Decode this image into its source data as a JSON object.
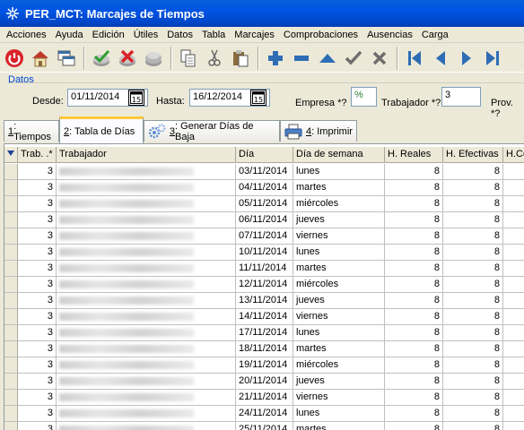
{
  "window": {
    "title": "PER_MCT: Marcajes de Tiempos"
  },
  "menu": [
    "Acciones",
    "Ayuda",
    "Edición",
    "Útiles",
    "Datos",
    "Tabla",
    "Marcajes",
    "Comprobaciones",
    "Ausencias",
    "Carga"
  ],
  "toolbar": {
    "buttons": [
      "power-icon",
      "home-icon",
      "windows-icon",
      "check-all-icon",
      "cancel-all-icon",
      "refresh-icon",
      "copy-icon",
      "cut-icon",
      "paste-icon",
      "add-icon",
      "remove-icon",
      "up-icon",
      "accept-icon",
      "cancel-icon",
      "first-icon",
      "previous-icon",
      "next-icon",
      "last-icon"
    ]
  },
  "filters": {
    "legend": "Datos",
    "desde_label": "Desde:",
    "desde_value": "01/11/2014",
    "hasta_label": "Hasta:",
    "hasta_value": "16/12/2014",
    "calendar_glyph": "15",
    "empresa_label": "Empresa *?",
    "empresa_value": "%",
    "trabajador_label": "Trabajador *?",
    "trabajador_value": "3",
    "prov_label": "Prov. *?"
  },
  "tabs": [
    {
      "key": "1",
      "label": ": Tiempos"
    },
    {
      "key": "2",
      "label": ": Tabla de Días"
    },
    {
      "key": "3",
      "label": ": Generar Días de Baja"
    },
    {
      "key": "4",
      "label": ": Imprimir"
    }
  ],
  "grid": {
    "columns": [
      "",
      "Trab. .*",
      "Trabajador",
      "Día",
      "Día de semana",
      "H. Reales",
      "H. Efectivas",
      "H.Co"
    ],
    "rows": [
      {
        "trab": "3",
        "dia": "03/11/2014",
        "semana": "lunes",
        "reales": "8",
        "efectivas": "8"
      },
      {
        "trab": "3",
        "dia": "04/11/2014",
        "semana": "martes",
        "reales": "8",
        "efectivas": "8"
      },
      {
        "trab": "3",
        "dia": "05/11/2014",
        "semana": "miércoles",
        "reales": "8",
        "efectivas": "8"
      },
      {
        "trab": "3",
        "dia": "06/11/2014",
        "semana": "jueves",
        "reales": "8",
        "efectivas": "8"
      },
      {
        "trab": "3",
        "dia": "07/11/2014",
        "semana": "viernes",
        "reales": "8",
        "efectivas": "8"
      },
      {
        "trab": "3",
        "dia": "10/11/2014",
        "semana": "lunes",
        "reales": "8",
        "efectivas": "8"
      },
      {
        "trab": "3",
        "dia": "11/11/2014",
        "semana": "martes",
        "reales": "8",
        "efectivas": "8"
      },
      {
        "trab": "3",
        "dia": "12/11/2014",
        "semana": "miércoles",
        "reales": "8",
        "efectivas": "8"
      },
      {
        "trab": "3",
        "dia": "13/11/2014",
        "semana": "jueves",
        "reales": "8",
        "efectivas": "8"
      },
      {
        "trab": "3",
        "dia": "14/11/2014",
        "semana": "viernes",
        "reales": "8",
        "efectivas": "8"
      },
      {
        "trab": "3",
        "dia": "17/11/2014",
        "semana": "lunes",
        "reales": "8",
        "efectivas": "8"
      },
      {
        "trab": "3",
        "dia": "18/11/2014",
        "semana": "martes",
        "reales": "8",
        "efectivas": "8"
      },
      {
        "trab": "3",
        "dia": "19/11/2014",
        "semana": "miércoles",
        "reales": "8",
        "efectivas": "8"
      },
      {
        "trab": "3",
        "dia": "20/11/2014",
        "semana": "jueves",
        "reales": "8",
        "efectivas": "8"
      },
      {
        "trab": "3",
        "dia": "21/11/2014",
        "semana": "viernes",
        "reales": "8",
        "efectivas": "8"
      },
      {
        "trab": "3",
        "dia": "24/11/2014",
        "semana": "lunes",
        "reales": "8",
        "efectivas": "8"
      },
      {
        "trab": "3",
        "dia": "25/11/2014",
        "semana": "martes",
        "reales": "8",
        "efectivas": "8"
      }
    ]
  }
}
